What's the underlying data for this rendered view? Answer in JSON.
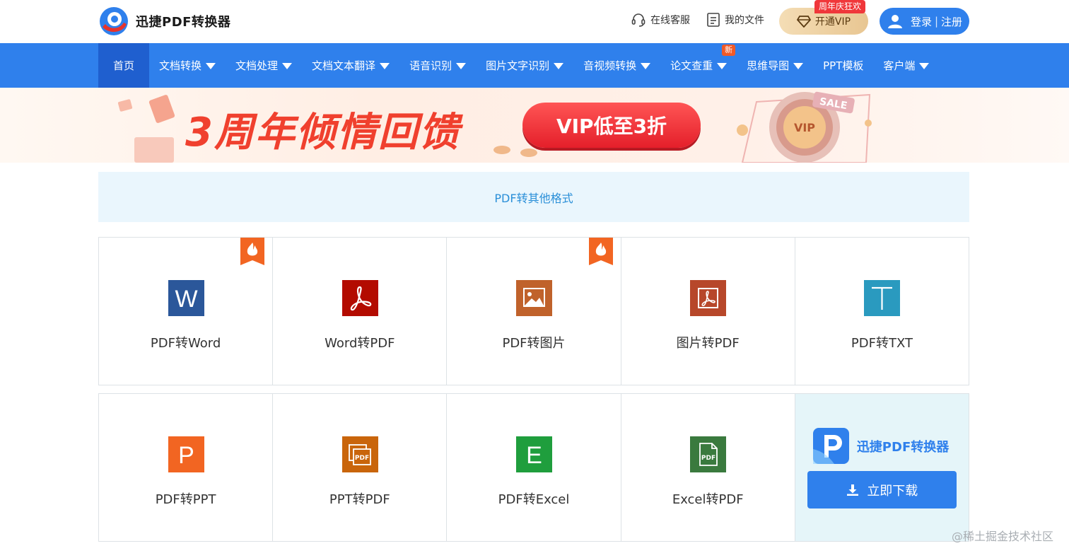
{
  "header": {
    "logo_text": "迅捷PDF转换器",
    "service_label": "在线客服",
    "files_label": "我的文件",
    "vip_label": "开通VIP",
    "vip_tag": "周年庆狂欢",
    "login_label": "登录",
    "login_sep": "|",
    "register_label": "注册"
  },
  "nav": {
    "items": [
      {
        "label": "首页"
      },
      {
        "label": "文档转换"
      },
      {
        "label": "文档处理"
      },
      {
        "label": "文档文本翻译"
      },
      {
        "label": "语音识别"
      },
      {
        "label": "图片文字识别"
      },
      {
        "label": "音视频转换"
      },
      {
        "label": "论文查重",
        "badge": "新"
      },
      {
        "label": "思维导图"
      },
      {
        "label": "PPT模板"
      },
      {
        "label": "客户端"
      }
    ]
  },
  "banner": {
    "title": "3周年倾情回馈",
    "pill": "VIP低至3折",
    "sale_tag": "SALE",
    "coin_text": "VIP"
  },
  "section": {
    "title": "PDF转其他格式"
  },
  "tools_row1": [
    {
      "label": "PDF转Word",
      "icon": "word-icon",
      "color": "#2b579a",
      "hot": true
    },
    {
      "label": "Word转PDF",
      "icon": "pdf-icon",
      "color": "#b30b00",
      "hot": false
    },
    {
      "label": "PDF转图片",
      "icon": "image-icon",
      "color": "#c0622b",
      "hot": true
    },
    {
      "label": "图片转PDF",
      "icon": "pdf-frame-icon",
      "color": "#b7472a",
      "hot": false
    },
    {
      "label": "PDF转TXT",
      "icon": "txt-icon",
      "color": "#2a9abf",
      "hot": false
    }
  ],
  "tools_row2": [
    {
      "label": "PDF转PPT",
      "icon": "ppt-icon",
      "color": "#f26522"
    },
    {
      "label": "PPT转PDF",
      "icon": "ppt-pdf-icon",
      "color": "#c9650b"
    },
    {
      "label": "PDF转Excel",
      "icon": "excel-icon",
      "color": "#1f9e3d"
    },
    {
      "label": "Excel转PDF",
      "icon": "excel-pdf-icon",
      "color": "#3a7a3e"
    }
  ],
  "promo": {
    "app_name": "迅捷PDF转换器",
    "download_label": "立即下载"
  },
  "watermark": "@稀土掘金技术社区",
  "colors": {
    "primary": "#2f80ec",
    "nav_active": "#1f5fcf",
    "banner_red": "#f0402e",
    "hot_orange": "#f26522"
  }
}
